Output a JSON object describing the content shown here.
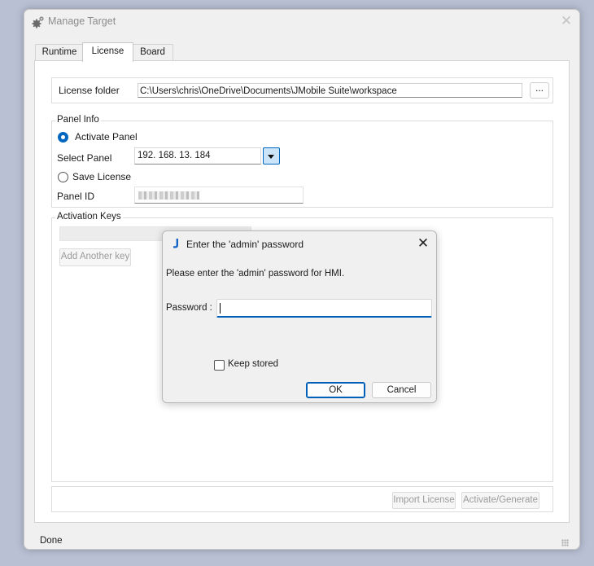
{
  "window": {
    "title": "Manage Target",
    "close_glyph": "✕"
  },
  "tabs": [
    {
      "label": "Runtime"
    },
    {
      "label": "License"
    },
    {
      "label": "Board"
    }
  ],
  "license": {
    "folder_label": "License folder",
    "folder_value": "C:\\Users\\chris\\OneDrive\\Documents\\JMobile Suite\\workspace",
    "browse_label": "..."
  },
  "panel_info": {
    "title": "Panel Info",
    "activate_label": "Activate Panel",
    "select_panel_label": "Select Panel",
    "select_panel_value": "192. 168. 13. 184",
    "save_license_label": "Save License",
    "panel_id_label": "Panel ID"
  },
  "activation_keys": {
    "title": "Activation Keys",
    "add_key_label": "Add Another key"
  },
  "buttons": {
    "import_license": "Import License",
    "activate_generate": "Activate/Generate"
  },
  "status": {
    "text": "Done"
  },
  "dialog": {
    "title": "Enter the 'admin' password",
    "close_glyph": "✕",
    "message": "Please enter the 'admin' password for HMI.",
    "password_label": "Password  :",
    "password_value": "",
    "keep_stored_label": "Keep stored",
    "ok_label": "OK",
    "cancel_label": "Cancel",
    "icon_color": "#1464c8"
  },
  "icons": {
    "app": "gear-icon",
    "dialog": "jmobile-logo-icon"
  }
}
